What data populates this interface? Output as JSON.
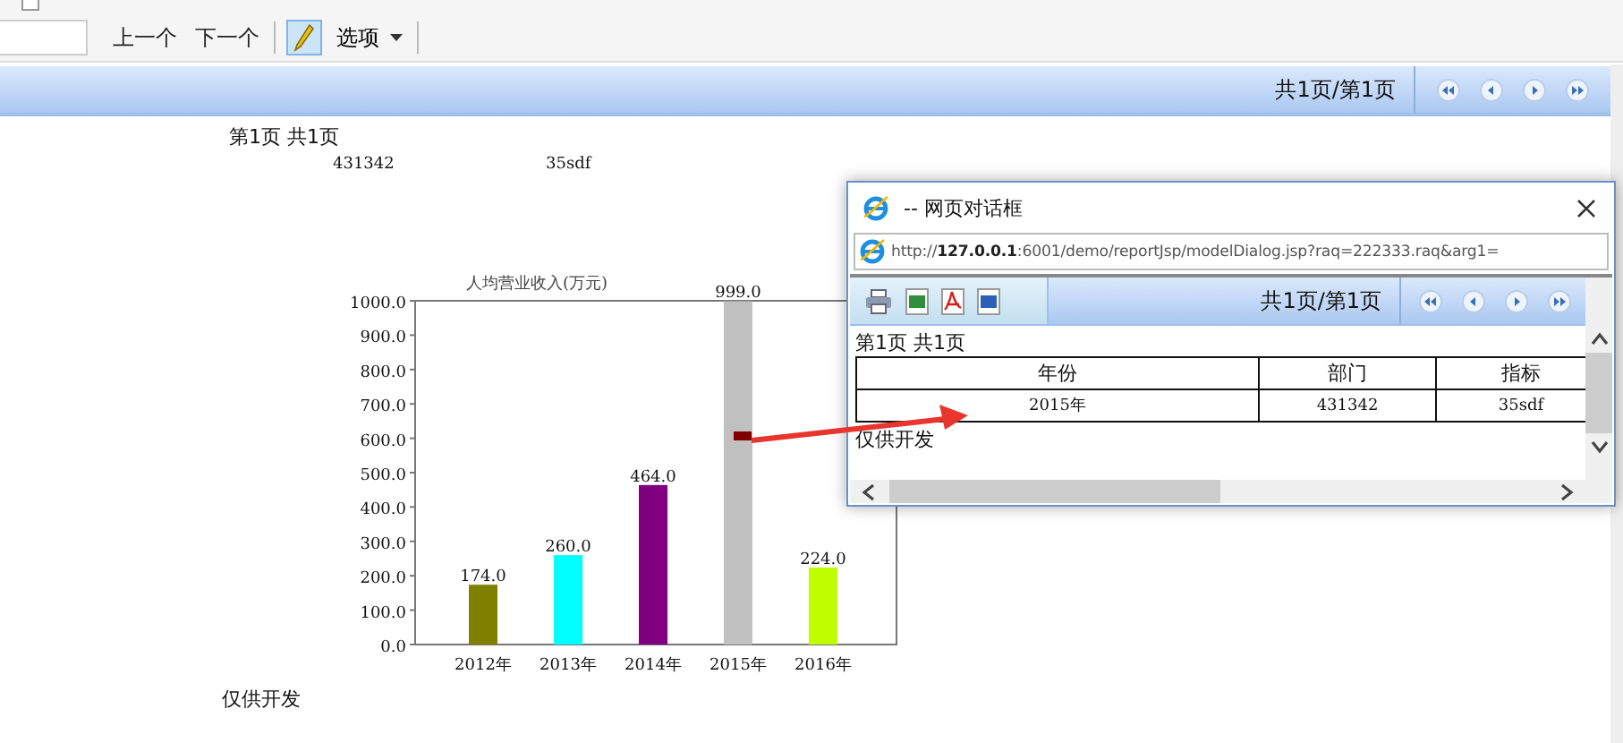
{
  "toolbar": {
    "buttons": [
      "上一个",
      "下一个"
    ],
    "pen_button": {
      "selected": true
    },
    "options_menu": "选项"
  },
  "report_bar": {
    "page_info": "共1页/第1页"
  },
  "report": {
    "page_label": "第1页  共1页",
    "cells": [
      "431342",
      "35sdf"
    ],
    "chart_data": {
      "type": "bar",
      "title": "人均营业收入(万元)",
      "stacked": true,
      "categories": [
        "2012年",
        "2013年",
        "2014年",
        "2015年",
        "2016年"
      ],
      "series": [
        {
          "color": "#808000",
          "values": [
            174,
            null,
            null,
            null,
            null
          ],
          "value_labels": [
            "174.0",
            null,
            null,
            null,
            null
          ]
        },
        {
          "color": "#00ffff",
          "values": [
            null,
            260,
            null,
            null,
            null
          ],
          "value_labels": [
            null,
            "260.0",
            null,
            null,
            null
          ]
        },
        {
          "color": "#800080",
          "values": [
            null,
            null,
            464,
            null,
            null
          ],
          "value_labels": [
            null,
            null,
            "464.0",
            null,
            null
          ]
        },
        {
          "color": "#c0c0c0",
          "values": [
            null,
            null,
            null,
            999,
            null
          ],
          "value_labels": [
            null,
            null,
            null,
            "999.0",
            null
          ]
        },
        {
          "color": "#c0ff00",
          "values": [
            null,
            null,
            null,
            null,
            224
          ],
          "value_labels": [
            null,
            null,
            null,
            null,
            "224.0"
          ]
        }
      ],
      "ylim": [
        0,
        1000
      ],
      "yticks": [
        {
          "value": 0,
          "label": "0.0"
        },
        {
          "value": 100,
          "label": "100.0"
        },
        {
          "value": 200,
          "label": "200.0"
        },
        {
          "value": 300,
          "label": "300.0"
        },
        {
          "value": 400,
          "label": "400.0"
        },
        {
          "value": 500,
          "label": "500.0"
        },
        {
          "value": 600,
          "label": "600.0"
        },
        {
          "value": 700,
          "label": "700.0"
        },
        {
          "value": 800,
          "label": "800.0"
        },
        {
          "value": 900,
          "label": "900.0"
        },
        {
          "value": 1000,
          "label": "1000.0"
        }
      ],
      "data_labels": "value_labels"
    },
    "footer": "仅供开发"
  },
  "dialog": {
    "title": "-- 网页对话框",
    "url": "http://**127.0.0.1**:6001/demo/reportJsp/modelDialog.jsp?raq=222333.raq&arg1=",
    "page_info": "共1页/第1页",
    "page_label": "第1页  共1页",
    "table": {
      "columns": [
        "年份",
        "部门",
        "指标"
      ],
      "rows": [
        [
          "2015年",
          "431342",
          "35sdf"
        ]
      ]
    },
    "footer": "仅供开发"
  }
}
